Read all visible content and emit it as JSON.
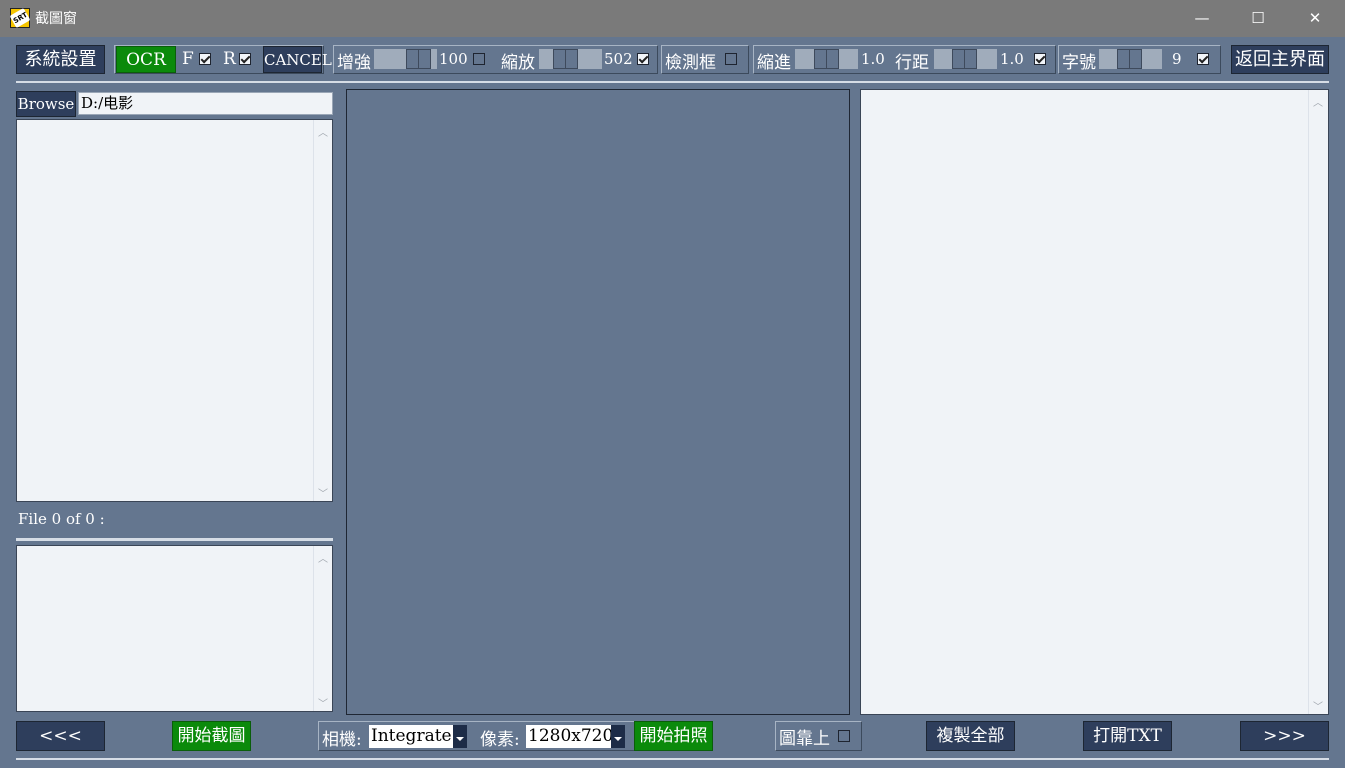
{
  "window": {
    "title": "截圖窗",
    "minimize": "—",
    "maximize": "☐",
    "close": "✕",
    "icon": "srt-app-icon",
    "icon_text": "SRT"
  },
  "toolbar": {
    "settings": "系統設置",
    "ocr": "OCR",
    "f_label": "F",
    "f_checked": true,
    "r_label": "R",
    "r_checked": true,
    "cancel": "CANCEL",
    "enhance_label": "增強",
    "enhance_value": "100",
    "enhance_checked": false,
    "zoom_label": "縮放",
    "zoom_value": "502",
    "zoom_checked": true,
    "detect_label": "檢測框",
    "detect_checked": false,
    "indent_label": "縮進",
    "indent_value": "1.0",
    "linespace_label": "行距",
    "linespace_value": "1.0",
    "linespace_checked": true,
    "fontsize_label": "字號",
    "fontsize_value": "9",
    "fontsize_checked": true,
    "back_main": "返回主界面"
  },
  "left": {
    "browse": "Browse",
    "path": "D:/电影",
    "file_status": "File 0 of 0 :"
  },
  "bottom": {
    "prev": "<<<",
    "start_capture": "開始截圖",
    "camera_label": "相機:",
    "camera_value": "Integrate",
    "pixel_label": "像素:",
    "pixel_value": "1280x720",
    "start_photo": "開始拍照",
    "on_top_label": "圖靠上",
    "on_top_checked": false,
    "copy_all": "複製全部",
    "open_txt": "打開TXT",
    "next": ">>>"
  },
  "colors": {
    "background": "#64768f",
    "green": "#0b8a0b",
    "button": "#2e3e5c",
    "panel": "#f0f3f7"
  }
}
